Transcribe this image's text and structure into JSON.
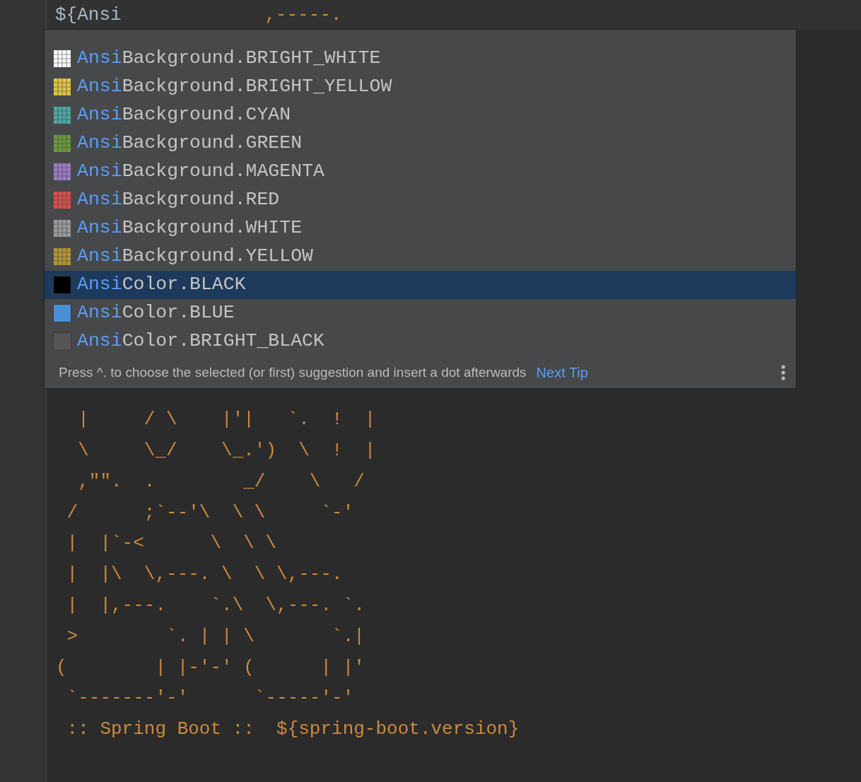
{
  "editor": {
    "typed": "${Ansi",
    "first_line_rest": "             ,-----.",
    "lines": [
      "  |     / \\    |'|   `.  !  |",
      "  \\     \\_/    \\_.')  \\  !  |",
      "  ,\"\".  .        _/    \\   /",
      " /      ;`--'\\  \\ \\     `-'",
      " |  |`-<      \\  \\ \\",
      " |  |\\  \\,---. \\  \\ \\,---.",
      " |  |,---.    `.\\  \\,---. `.",
      " >        `. | | \\       `.|",
      "(        | |-'-' (      | |'",
      " `-------'-'      `-----'-'",
      " :: Spring Boot ::  ${spring-boot.version}"
    ]
  },
  "completion": {
    "items": [
      {
        "kind": "background",
        "color": "#ffffff",
        "matched": "Ansi",
        "rest": "Background.BRIGHT_WHITE",
        "selected": false
      },
      {
        "kind": "background",
        "color": "#e2c446",
        "matched": "Ansi",
        "rest": "Background.BRIGHT_YELLOW",
        "selected": false
      },
      {
        "kind": "background",
        "color": "#4fa8a2",
        "matched": "Ansi",
        "rest": "Background.CYAN",
        "selected": false
      },
      {
        "kind": "background",
        "color": "#6a9a3c",
        "matched": "Ansi",
        "rest": "Background.GREEN",
        "selected": false
      },
      {
        "kind": "background",
        "color": "#9c7cc4",
        "matched": "Ansi",
        "rest": "Background.MAGENTA",
        "selected": false
      },
      {
        "kind": "background",
        "color": "#d6524c",
        "matched": "Ansi",
        "rest": "Background.RED",
        "selected": false
      },
      {
        "kind": "background",
        "color": "#9a9a9a",
        "matched": "Ansi",
        "rest": "Background.WHITE",
        "selected": false
      },
      {
        "kind": "background",
        "color": "#b39434",
        "matched": "Ansi",
        "rest": "Background.YELLOW",
        "selected": false
      },
      {
        "kind": "color",
        "color": "#000000",
        "matched": "Ansi",
        "rest": "Color.BLACK",
        "selected": true
      },
      {
        "kind": "color",
        "color": "#4a8fd8",
        "matched": "Ansi",
        "rest": "Color.BLUE",
        "selected": false
      },
      {
        "kind": "color",
        "color": "#555555",
        "matched": "Ansi",
        "rest": "Color.BRIGHT_BLACK",
        "selected": false
      }
    ],
    "tip": "Press ^. to choose the selected (or first) suggestion and insert a dot afterwards",
    "next_tip": "Next Tip"
  }
}
